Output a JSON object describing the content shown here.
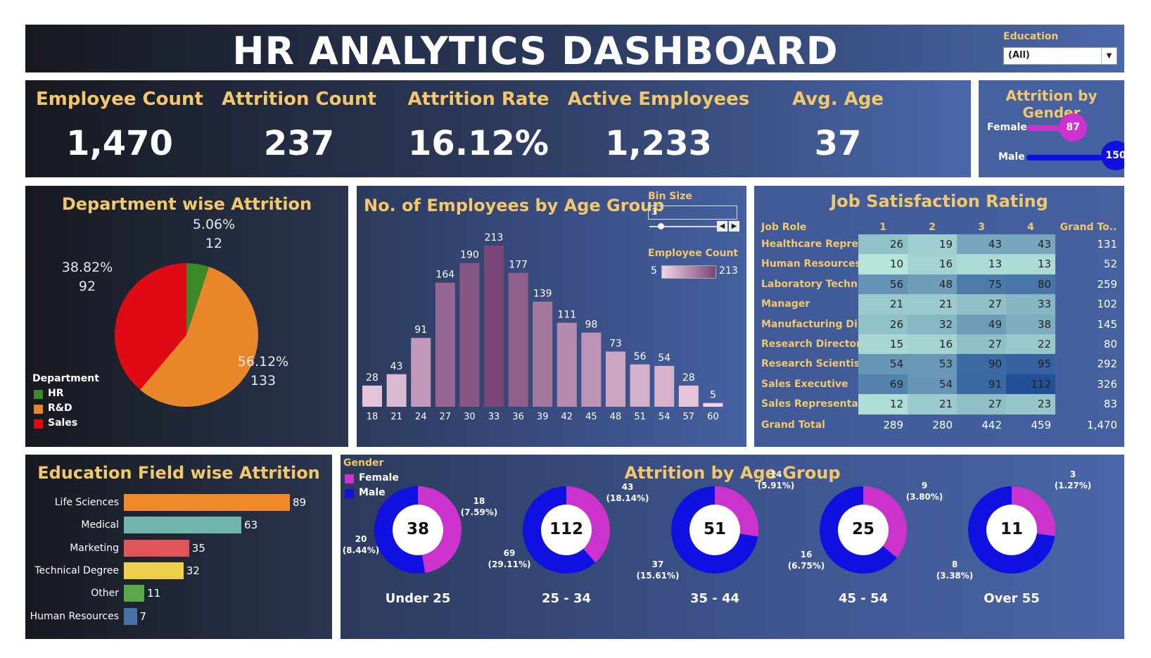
{
  "header": {
    "title": "HR ANALYTICS DASHBOARD",
    "filter_label": "Education",
    "filter_value": "(All)"
  },
  "kpis": [
    {
      "label": "Employee Count",
      "value": "1,470"
    },
    {
      "label": "Attrition Count",
      "value": "237"
    },
    {
      "label": "Attrition Rate",
      "value": "16.12%"
    },
    {
      "label": "Active Employees",
      "value": "1,233"
    },
    {
      "label": "Avg. Age",
      "value": "37"
    }
  ],
  "gender": {
    "title": "Attrition by Gender",
    "female_label": "Female",
    "female_value": "87",
    "female_fraction": 0.58,
    "male_label": "Male",
    "male_value": "150",
    "male_fraction": 1.0,
    "colors": {
      "female": "#cc33cc",
      "male": "#1010e0"
    }
  },
  "department": {
    "title": "Department wise Attrition",
    "legend_title": "Department",
    "slices": [
      {
        "name": "HR",
        "pct": "5.06%",
        "count": "12",
        "value": 12,
        "color": "#3a8a2a"
      },
      {
        "name": "R&D",
        "pct": "56.12%",
        "count": "133",
        "value": 133,
        "color": "#e8862a"
      },
      {
        "name": "Sales",
        "pct": "38.82%",
        "count": "92",
        "value": 92,
        "color": "#e00a14"
      }
    ]
  },
  "age_hist": {
    "title": "No. of Employees by Age Group",
    "bin_label": "Bin Size",
    "bin_value": "3",
    "legend_title": "Employee Count",
    "legend_min": "5",
    "legend_max": "213"
  },
  "job_sat": {
    "title": "Job Satisfaction Rating",
    "col_headers": [
      "Job Role",
      "1",
      "2",
      "3",
      "4",
      "Grand To.."
    ],
    "rows": [
      {
        "role": "Healthcare Repres..",
        "v": [
          "26",
          "19",
          "43",
          "43"
        ],
        "total": "131"
      },
      {
        "role": "Human Resources",
        "v": [
          "10",
          "16",
          "13",
          "13"
        ],
        "total": "52"
      },
      {
        "role": "Laboratory Techni..",
        "v": [
          "56",
          "48",
          "75",
          "80"
        ],
        "total": "259"
      },
      {
        "role": "Manager",
        "v": [
          "21",
          "21",
          "27",
          "33"
        ],
        "total": "102"
      },
      {
        "role": "Manufacturing Dir..",
        "v": [
          "26",
          "32",
          "49",
          "38"
        ],
        "total": "145"
      },
      {
        "role": "Research Director",
        "v": [
          "15",
          "16",
          "27",
          "22"
        ],
        "total": "80"
      },
      {
        "role": "Research Scientist",
        "v": [
          "54",
          "53",
          "90",
          "95"
        ],
        "total": "292"
      },
      {
        "role": "Sales Executive",
        "v": [
          "69",
          "54",
          "91",
          "112"
        ],
        "total": "326"
      },
      {
        "role": "Sales Representati..",
        "v": [
          "12",
          "21",
          "27",
          "23"
        ],
        "total": "83"
      }
    ],
    "grand_total": {
      "label": "Grand Total",
      "v": [
        "289",
        "280",
        "442",
        "459"
      ],
      "total": "1,470"
    }
  },
  "edu_field": {
    "title": "Education Field wise Attrition"
  },
  "age_attr": {
    "title": "Attrition by Age Group",
    "legend_title": "Gender",
    "female_label": "Female",
    "male_label": "Male",
    "groups": [
      {
        "label": "Under 25",
        "total": "38",
        "female": "18",
        "female_pct": "(7.59%)",
        "male": "20",
        "male_pct": "(8.44%)",
        "female_fraction": 0.4737
      },
      {
        "label": "25 - 34",
        "total": "112",
        "female": "43",
        "female_pct": "(18.14%)",
        "male": "69",
        "male_pct": "(29.11%)",
        "female_fraction": 0.3839
      },
      {
        "label": "35 - 44",
        "total": "51",
        "female": "14",
        "female_pct": "(5.91%)",
        "male": "37",
        "male_pct": "(15.61%)",
        "female_fraction": 0.2745
      },
      {
        "label": "45 - 54",
        "total": "25",
        "female": "9",
        "female_pct": "(3.80%)",
        "male": "16",
        "male_pct": "(6.75%)",
        "female_fraction": 0.36
      },
      {
        "label": "Over 55",
        "total": "11",
        "female": "3",
        "female_pct": "(1.27%)",
        "male": "8",
        "male_pct": "(3.38%)",
        "female_fraction": 0.2727
      }
    ]
  },
  "chart_data": [
    {
      "type": "pie",
      "title": "Department wise Attrition",
      "categories": [
        "HR",
        "R&D",
        "Sales"
      ],
      "values": [
        12,
        133,
        92
      ]
    },
    {
      "type": "bar",
      "title": "No. of Employees by Age Group",
      "categories": [
        "18",
        "21",
        "24",
        "27",
        "30",
        "33",
        "36",
        "39",
        "42",
        "45",
        "48",
        "51",
        "54",
        "57",
        "60"
      ],
      "values": [
        28,
        43,
        91,
        164,
        190,
        213,
        177,
        139,
        111,
        98,
        73,
        56,
        54,
        28,
        5
      ],
      "ylim": [
        0,
        213
      ]
    },
    {
      "type": "bar",
      "title": "Education Field wise Attrition",
      "categories": [
        "Life Sciences",
        "Medical",
        "Marketing",
        "Technical Degree",
        "Other",
        "Human Resources"
      ],
      "values": [
        89,
        63,
        35,
        32,
        11,
        7
      ],
      "colors": [
        "#f0892a",
        "#6fb5ae",
        "#e05555",
        "#eecf4d",
        "#5aa84a",
        "#4a70a8"
      ]
    }
  ]
}
